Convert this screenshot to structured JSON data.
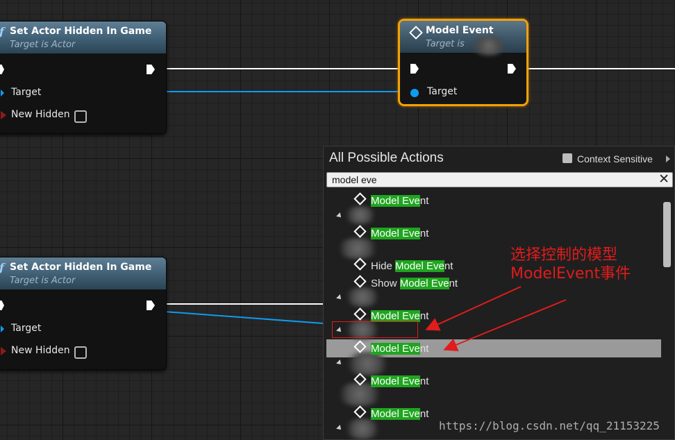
{
  "nodes": [
    {
      "title": "Set Actor Hidden In Game",
      "subtitle": "Target is Actor",
      "pins": {
        "target": "Target",
        "new_hidden": "New Hidden"
      }
    },
    {
      "title": "Set Actor Hidden In Game",
      "subtitle": "Target is Actor",
      "pins": {
        "target": "Target",
        "new_hidden": "New Hidden"
      }
    }
  ],
  "event_node": {
    "title": "Model Event",
    "subtitle": "Target is",
    "pins": {
      "target": "Target"
    }
  },
  "panel": {
    "title": "All Possible Actions",
    "context_sensitive_label": "Context Sensitive",
    "search_value": "model eve",
    "clear_icon": "close-icon",
    "items": [
      {
        "prefix": "",
        "match": "Model Eve",
        "suffix": "nt"
      },
      {
        "prefix": "",
        "match": "Model Eve",
        "suffix": "nt"
      },
      {
        "prefix": "Hide ",
        "match": "Model Eve",
        "suffix": "nt"
      },
      {
        "prefix": "Show ",
        "match": "Model Eve",
        "suffix": "nt"
      },
      {
        "prefix": "",
        "match": "Model Eve",
        "suffix": "nt"
      },
      {
        "prefix": "",
        "match": "Model Eve",
        "suffix": "nt"
      },
      {
        "prefix": "",
        "match": "Model Eve",
        "suffix": "nt"
      },
      {
        "prefix": "",
        "match": "Model Eve",
        "suffix": "nt"
      }
    ],
    "selected_index": 5
  },
  "annotation": {
    "line1": "选择控制的模型",
    "line2": "ModelEvent事件",
    "color": "#e01c1c"
  },
  "watermark": "https://blog.csdn.net/qq_21153225",
  "colors": {
    "exec_wire": "#ffffff",
    "object_wire": "#0e9cf0",
    "event_border": "#f3a20a",
    "highlight": "#1fa51f"
  }
}
